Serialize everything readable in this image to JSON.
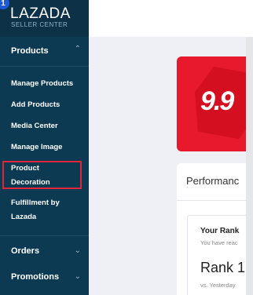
{
  "step_badge": "1",
  "logo": {
    "word": "LAZADA",
    "sub": "SELLER CENTER"
  },
  "sidebar": {
    "products": {
      "label": "Products",
      "chevron": "^"
    },
    "items": [
      {
        "label": "Manage Products"
      },
      {
        "label": "Add Products"
      },
      {
        "label": "Media Center"
      },
      {
        "label": "Manage Image"
      },
      {
        "label": "Product Decoration"
      },
      {
        "label": "Fulfillment by Lazada"
      }
    ],
    "orders": {
      "label": "Orders",
      "chevron": "v"
    },
    "promotions": {
      "label": "Promotions",
      "chevron": "v"
    }
  },
  "promo": {
    "text": "9.9"
  },
  "performance": {
    "title": "Performanc",
    "rank_heading": "Your Rank",
    "rank_sub": "You have reac",
    "rank_value": "Rank 1",
    "rank_vs": "vs. Yesterday"
  },
  "colors": {
    "sidebar": "#0b3a52",
    "highlight": "#e0243a",
    "promo": "#e8192c"
  }
}
